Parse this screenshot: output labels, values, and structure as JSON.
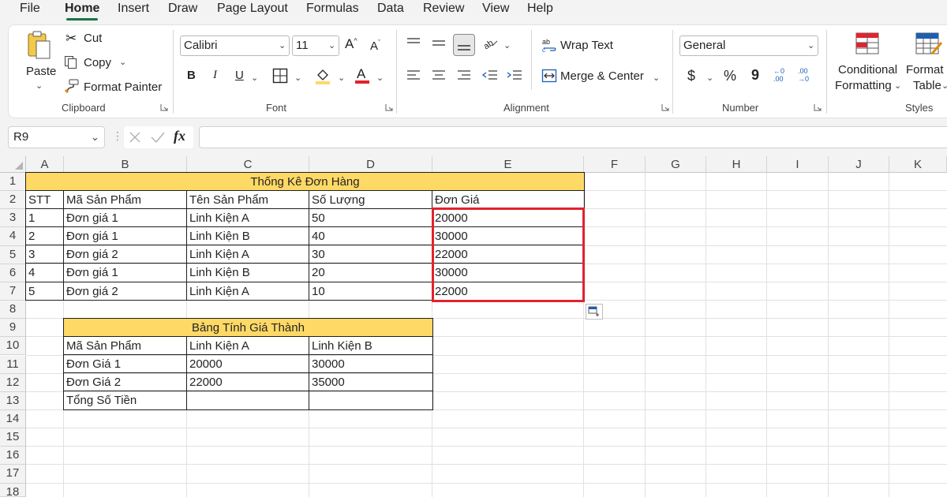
{
  "menu": {
    "tabs": [
      "File",
      "Home",
      "Insert",
      "Draw",
      "Page Layout",
      "Formulas",
      "Data",
      "Review",
      "View",
      "Help"
    ],
    "active": "Home"
  },
  "ribbon": {
    "clipboard": {
      "paste": "Paste",
      "cut": "Cut",
      "copy": "Copy",
      "format_painter": "Format Painter",
      "title": "Clipboard"
    },
    "font": {
      "name": "Calibri",
      "size": "11",
      "bold": "B",
      "italic": "I",
      "underline": "U",
      "title": "Font"
    },
    "alignment": {
      "wrap_text": "Wrap Text",
      "merge_center": "Merge & Center",
      "title": "Alignment"
    },
    "number": {
      "format": "General",
      "currency": "$",
      "percent": "%",
      "comma": "9",
      "inc_decimal": "←0 .00",
      "dec_decimal": ".00 →0",
      "title": "Number"
    },
    "styles": {
      "conditional_line1": "Conditional",
      "conditional_line2": "Formatting",
      "format_table_line1": "Format as",
      "format_table_line2": "Table",
      "title": "Styles"
    }
  },
  "formula_bar": {
    "name_box": "R9",
    "fx": "fx",
    "value": ""
  },
  "sheet": {
    "columns": [
      "A",
      "B",
      "C",
      "D",
      "E",
      "F",
      "G",
      "H",
      "I",
      "J",
      "K"
    ],
    "rows": [
      "1",
      "2",
      "3",
      "4",
      "5",
      "6",
      "7",
      "8",
      "9",
      "10",
      "11",
      "12",
      "13",
      "14",
      "15",
      "16",
      "17",
      "18"
    ],
    "order_table": {
      "title": "Thống Kê Đơn Hàng",
      "headers": [
        "STT",
        "Mã Sản Phẩm",
        "Tên Sản Phẩm",
        "Số Lượng",
        "Đơn Giá"
      ],
      "rows": [
        [
          "1",
          "Đơn giá 1",
          "Linh Kiện A",
          "50",
          "20000"
        ],
        [
          "2",
          "Đơn giá 1",
          "Linh Kiện B",
          "40",
          "30000"
        ],
        [
          "3",
          "Đơn giá 2",
          "Linh Kiện A",
          "30",
          "22000"
        ],
        [
          "4",
          "Đơn giá 1",
          "Linh Kiện B",
          "20",
          "30000"
        ],
        [
          "5",
          "Đơn giá 2",
          "Linh Kiện A",
          "10",
          "22000"
        ]
      ]
    },
    "price_table": {
      "title": "Bảng Tính Giá Thành",
      "headers": [
        "Mã Sản Phẩm",
        "Linh Kiện A",
        "Linh Kiện B"
      ],
      "rows": [
        [
          "Đơn Giá 1",
          "20000",
          "30000"
        ],
        [
          "Đơn Giá 2",
          "22000",
          "35000"
        ],
        [
          "Tổng Số Tiền",
          "",
          ""
        ]
      ]
    }
  },
  "colors": {
    "header_fill": "#ffd966",
    "highlight_border": "#e3222e",
    "accent": "#1a7343"
  }
}
